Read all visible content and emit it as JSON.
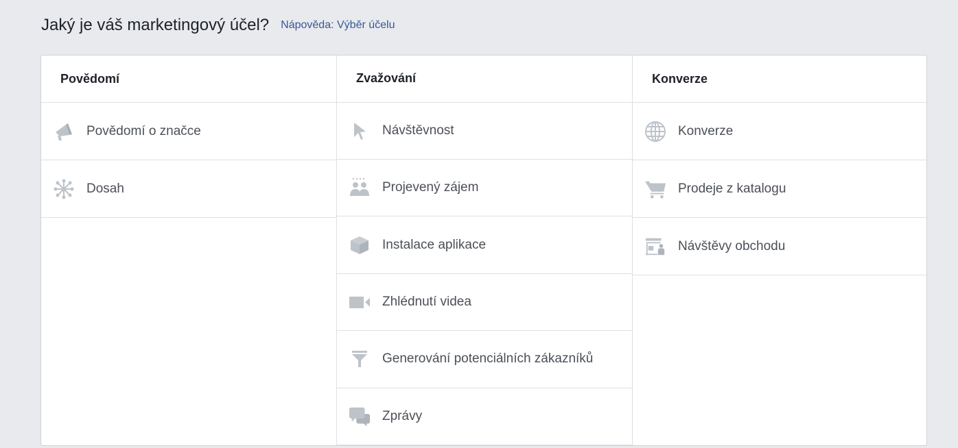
{
  "header": {
    "question": "Jaký je váš marketingový účel?",
    "help_link": "Nápověda: Výběr účelu"
  },
  "columns": [
    {
      "title": "Povědomí",
      "options": [
        {
          "label": "Povědomí o značce",
          "icon": "megaphone-icon"
        },
        {
          "label": "Dosah",
          "icon": "network-reach-icon"
        }
      ]
    },
    {
      "title": "Zvažování",
      "options": [
        {
          "label": "Návštěvnost",
          "icon": "cursor-pointer-icon"
        },
        {
          "label": "Projevený zájem",
          "icon": "people-engagement-icon"
        },
        {
          "label": "Instalace aplikace",
          "icon": "box-app-icon"
        },
        {
          "label": "Zhlédnutí videa",
          "icon": "video-camera-icon"
        },
        {
          "label": "Generování potenciálních zákazníků",
          "icon": "funnel-icon"
        },
        {
          "label": "Zprávy",
          "icon": "speech-bubbles-icon"
        }
      ]
    },
    {
      "title": "Konverze",
      "options": [
        {
          "label": "Konverze",
          "icon": "globe-icon"
        },
        {
          "label": "Prodeje z katalogu",
          "icon": "shopping-cart-icon"
        },
        {
          "label": "Návštěvy obchodu",
          "icon": "store-visit-icon"
        }
      ]
    }
  ],
  "colors": {
    "icon": "#bec3c9",
    "link": "#365899",
    "background": "#e9eaed"
  }
}
